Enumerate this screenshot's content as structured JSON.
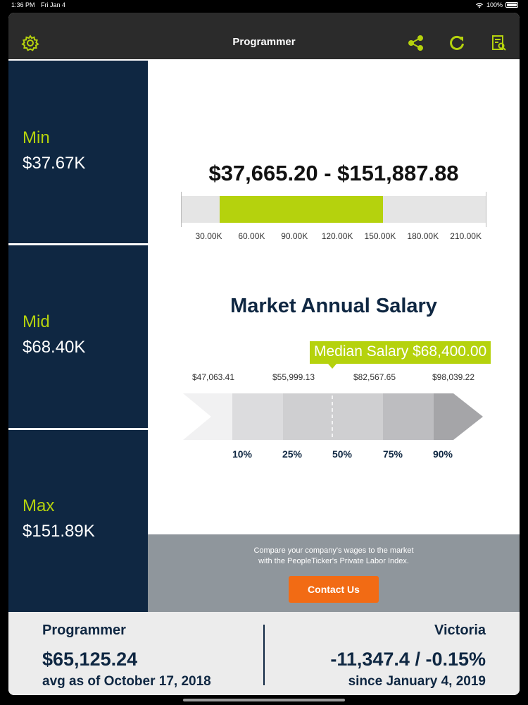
{
  "status_bar": {
    "time": "1:36 PM",
    "date": "Fri Jan 4",
    "battery": "100%"
  },
  "navbar": {
    "title": "Programmer",
    "icons": [
      "gear-icon",
      "share-icon",
      "refresh-icon",
      "report-icon"
    ],
    "icon_color": "#b5d20d"
  },
  "sidebar": {
    "tiles": [
      {
        "label": "Min",
        "value": "$37.67K"
      },
      {
        "label": "Mid",
        "value": "$68.40K"
      },
      {
        "label": "Max",
        "value": "$151.89K"
      }
    ]
  },
  "range": {
    "text": "$37,665.20 - $151,887.88",
    "min": 37665.2,
    "max": 151887.88,
    "scale_min": 11000,
    "scale_max": 224000,
    "scale_labels": [
      "30.00K",
      "60.00K",
      "90.00K",
      "120.00K",
      "150.00K",
      "180.00K",
      "210.00K"
    ],
    "scale_values": [
      30000,
      60000,
      90000,
      120000,
      150000,
      180000,
      210000
    ],
    "fill_color": "#b5d20d"
  },
  "market": {
    "title": "Market Annual Salary",
    "median_label": "Median Salary $68,400.00",
    "percentile_values": [
      "$47,063.41",
      "$55,999.13",
      "$82,567.65",
      "$98,039.22"
    ],
    "percentile_labels": [
      "10%",
      "25%",
      "50%",
      "75%",
      "90%"
    ]
  },
  "cta": {
    "text_line1": "Compare your company's wages to the market",
    "text_line2": "with the PeopleTicker's Private Labor Index.",
    "button_label": "Contact Us",
    "button_color": "#f26b14"
  },
  "footer": {
    "left": {
      "title": "Programmer",
      "value": "$65,125.24",
      "sub": "avg as of October 17, 2018"
    },
    "right": {
      "title": "Victoria",
      "value": "-11,347.4 / -0.15%",
      "sub": "since January 4, 2019"
    }
  }
}
